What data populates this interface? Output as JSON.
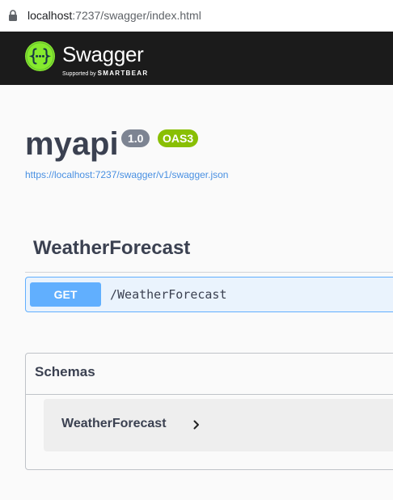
{
  "browser": {
    "url_host": "localhost",
    "url_rest": ":7237/swagger/index.html",
    "lock_icon": "lock-icon"
  },
  "topbar": {
    "brand": "Swagger",
    "tm": ".",
    "supported_by": "Supported by",
    "company": "SMARTBEAR",
    "logo_color": "#85ea2d",
    "background": "#1b1b1b"
  },
  "info": {
    "title": "myapi",
    "version": "1.0",
    "oas": "OAS3",
    "spec_url": "https://localhost:7237/swagger/v1/swagger.json"
  },
  "tags": [
    {
      "name": "WeatherForecast",
      "operations": [
        {
          "method": "GET",
          "path": "/WeatherForecast",
          "method_color": "#61affe"
        }
      ]
    }
  ],
  "schemas": {
    "title": "Schemas",
    "models": [
      {
        "name": "WeatherForecast",
        "icon": "chevron-right-icon"
      }
    ]
  }
}
